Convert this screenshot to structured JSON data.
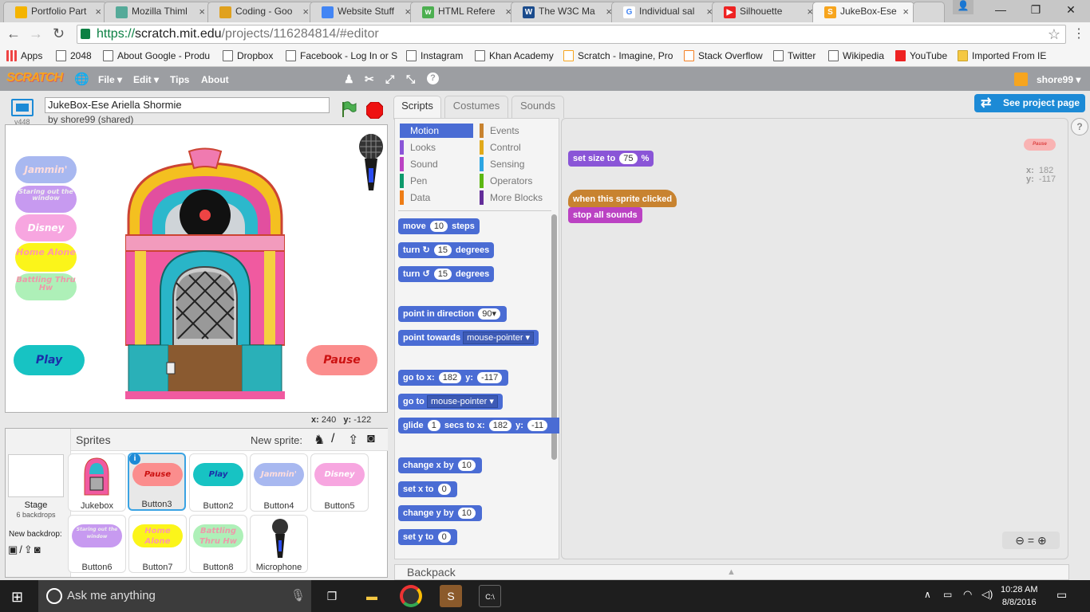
{
  "browser": {
    "tabs": [
      {
        "label": "Portfolio Part",
        "icon": "drive-icon",
        "color": "#f4b400"
      },
      {
        "label": "Mozilla Thiml",
        "icon": "thimble-icon",
        "color": "#5a9"
      },
      {
        "label": "Coding - Goo",
        "icon": "slides-icon",
        "color": "#e0a11e"
      },
      {
        "label": "Website Stuff",
        "icon": "docs-icon",
        "color": "#4285f4"
      },
      {
        "label": "HTML Refere",
        "icon": "w3-icon",
        "color": "#4caf50"
      },
      {
        "label": "The W3C Ma",
        "icon": "w3c-icon",
        "color": "#1a4b8c"
      },
      {
        "label": "Individual sal",
        "icon": "google-icon",
        "color": "#4285f4"
      },
      {
        "label": "Silhouette",
        "icon": "youtube-icon",
        "color": "#e22"
      },
      {
        "label": "JukeBox-Ese",
        "icon": "scratch-icon",
        "color": "#f7a51e"
      }
    ],
    "url": {
      "scheme": "https://",
      "host": "scratch.mit.edu",
      "path": "/projects/116284814/#editor"
    },
    "bookmarks": [
      "Apps",
      "2048",
      "About Google - Produ",
      "Dropbox",
      "Facebook - Log In or S",
      "Instagram",
      "Khan Academy",
      "Scratch - Imagine, Pro",
      "Stack Overflow",
      "Twitter",
      "Wikipedia",
      "YouTube",
      "Imported From IE"
    ]
  },
  "scratch_menu": {
    "logo": "SCRATCH",
    "items": [
      "File ▾",
      "Edit ▾",
      "Tips",
      "About"
    ],
    "user": "shore99 ▾"
  },
  "project": {
    "title": "JukeBox-Ese Ariella Shormie",
    "byline": "by shore99 (shared)",
    "version": "v448"
  },
  "stage": {
    "buttons": [
      "Jammin'",
      "Staring out the window",
      "Disney",
      "Home Alone",
      "Battling Thru Hw"
    ],
    "play_label": "Play",
    "pause_label": "Pause",
    "coords_x_label": "x:",
    "coords_x": "240",
    "coords_y_label": "y:",
    "coords_y": "-122"
  },
  "sprites": {
    "header": "Sprites",
    "new_sprite": "New sprite:",
    "stage_label": "Stage",
    "stage_backdrops": "6 backdrops",
    "new_backdrop": "New backdrop:",
    "list": [
      {
        "name": "Jukebox",
        "thumb": ""
      },
      {
        "name": "Button3",
        "thumb": "Pause"
      },
      {
        "name": "Button2",
        "thumb": "Play"
      },
      {
        "name": "Button4",
        "thumb": "Jammin'"
      },
      {
        "name": "Button5",
        "thumb": "Disney"
      },
      {
        "name": "Button6",
        "thumb": "Staring out the window"
      },
      {
        "name": "Button7",
        "thumb": "Home Alone"
      },
      {
        "name": "Button8",
        "thumb": "Battling Thru Hw"
      },
      {
        "name": "Microphone",
        "thumb": ""
      }
    ]
  },
  "editor_tabs": [
    "Scripts",
    "Costumes",
    "Sounds"
  ],
  "see_project": "See project page",
  "categories": {
    "left": [
      {
        "label": "Motion",
        "color": "#4a6cd4"
      },
      {
        "label": "Looks",
        "color": "#8a55d7"
      },
      {
        "label": "Sound",
        "color": "#bb42c3"
      },
      {
        "label": "Pen",
        "color": "#0e9a6c"
      },
      {
        "label": "Data",
        "color": "#ee7d16"
      }
    ],
    "right": [
      {
        "label": "Events",
        "color": "#c88330"
      },
      {
        "label": "Control",
        "color": "#e1a91a"
      },
      {
        "label": "Sensing",
        "color": "#2ca5e2"
      },
      {
        "label": "Operators",
        "color": "#5cb712"
      },
      {
        "label": "More Blocks",
        "color": "#632d99"
      }
    ]
  },
  "blocks": {
    "move": [
      "move",
      "10",
      "steps"
    ],
    "turn_cw": [
      "turn ↻",
      "15",
      "degrees"
    ],
    "turn_ccw": [
      "turn ↺",
      "15",
      "degrees"
    ],
    "point_dir": [
      "point in direction",
      "90▾"
    ],
    "point_towards": [
      "point towards",
      "mouse-pointer ▾"
    ],
    "goto_xy": [
      "go to x:",
      "182",
      "y:",
      "-117"
    ],
    "goto": [
      "go to",
      "mouse-pointer ▾"
    ],
    "glide": [
      "glide",
      "1",
      "secs to x:",
      "182",
      "y:",
      "-11"
    ],
    "change_x": [
      "change x by",
      "10"
    ],
    "set_x": [
      "set x to",
      "0"
    ],
    "change_y": [
      "change y by",
      "10"
    ],
    "set_y": [
      "set y to",
      "0"
    ]
  },
  "scripts": {
    "set_size": [
      "set size to",
      "75",
      "%"
    ],
    "hat": "when this sprite clicked",
    "stop": "stop all sounds",
    "sprite_thumb": "Pause",
    "x_label": "x:",
    "x": "182",
    "y_label": "y:",
    "y": "-117"
  },
  "backpack": "Backpack",
  "taskbar": {
    "search": "Ask me anything",
    "time": "10:28 AM",
    "date": "8/8/2016"
  }
}
